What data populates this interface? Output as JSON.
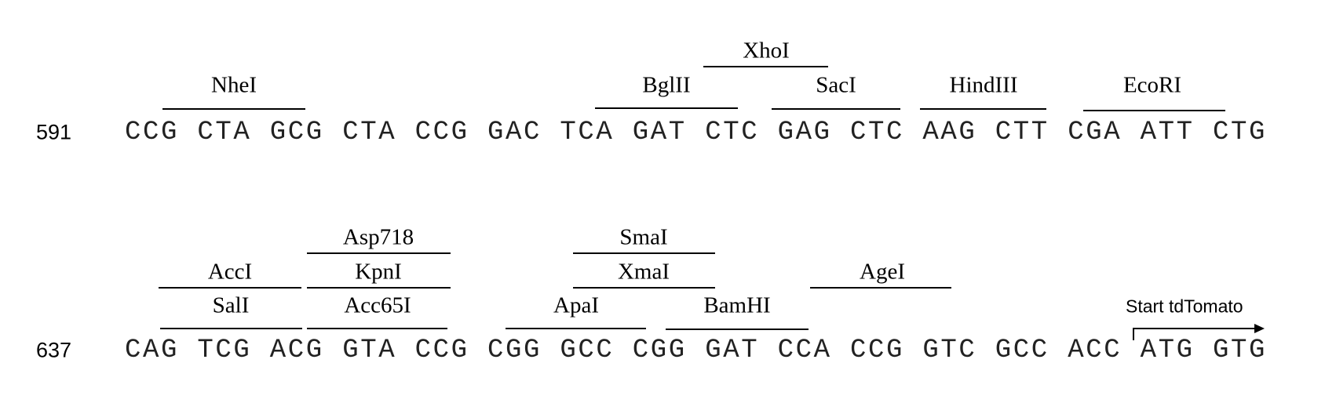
{
  "rows": [
    {
      "position": "591",
      "codons": [
        "CCG",
        "CTA",
        "GCG",
        "CTA",
        "CCG",
        "GAC",
        "TCA",
        "GAT",
        "CTC",
        "GAG",
        "CTC",
        "AAG",
        "CTT",
        "CGA",
        "ATT",
        "CTG"
      ],
      "sites": [
        "NheI",
        "BglII",
        "XhoI",
        "SacI",
        "HindIII",
        "EcoRI"
      ]
    },
    {
      "position": "637",
      "codons": [
        "CAG",
        "TCG",
        "ACG",
        "GTA",
        "CCG",
        "CGG",
        "GCC",
        "CGG",
        "GAT",
        "CCA",
        "CCG",
        "GTC",
        "GCC",
        "ACC",
        "ATG",
        "GTG"
      ],
      "sites": [
        "Asp718",
        "AccI",
        "KpnI",
        "SalI",
        "Acc65I",
        "SmaI",
        "XmaI",
        "ApaI",
        "BamHI",
        "AgeI"
      ]
    }
  ],
  "annotation": {
    "label": "Start tdTomato",
    "icon": "right-arrow-icon"
  }
}
